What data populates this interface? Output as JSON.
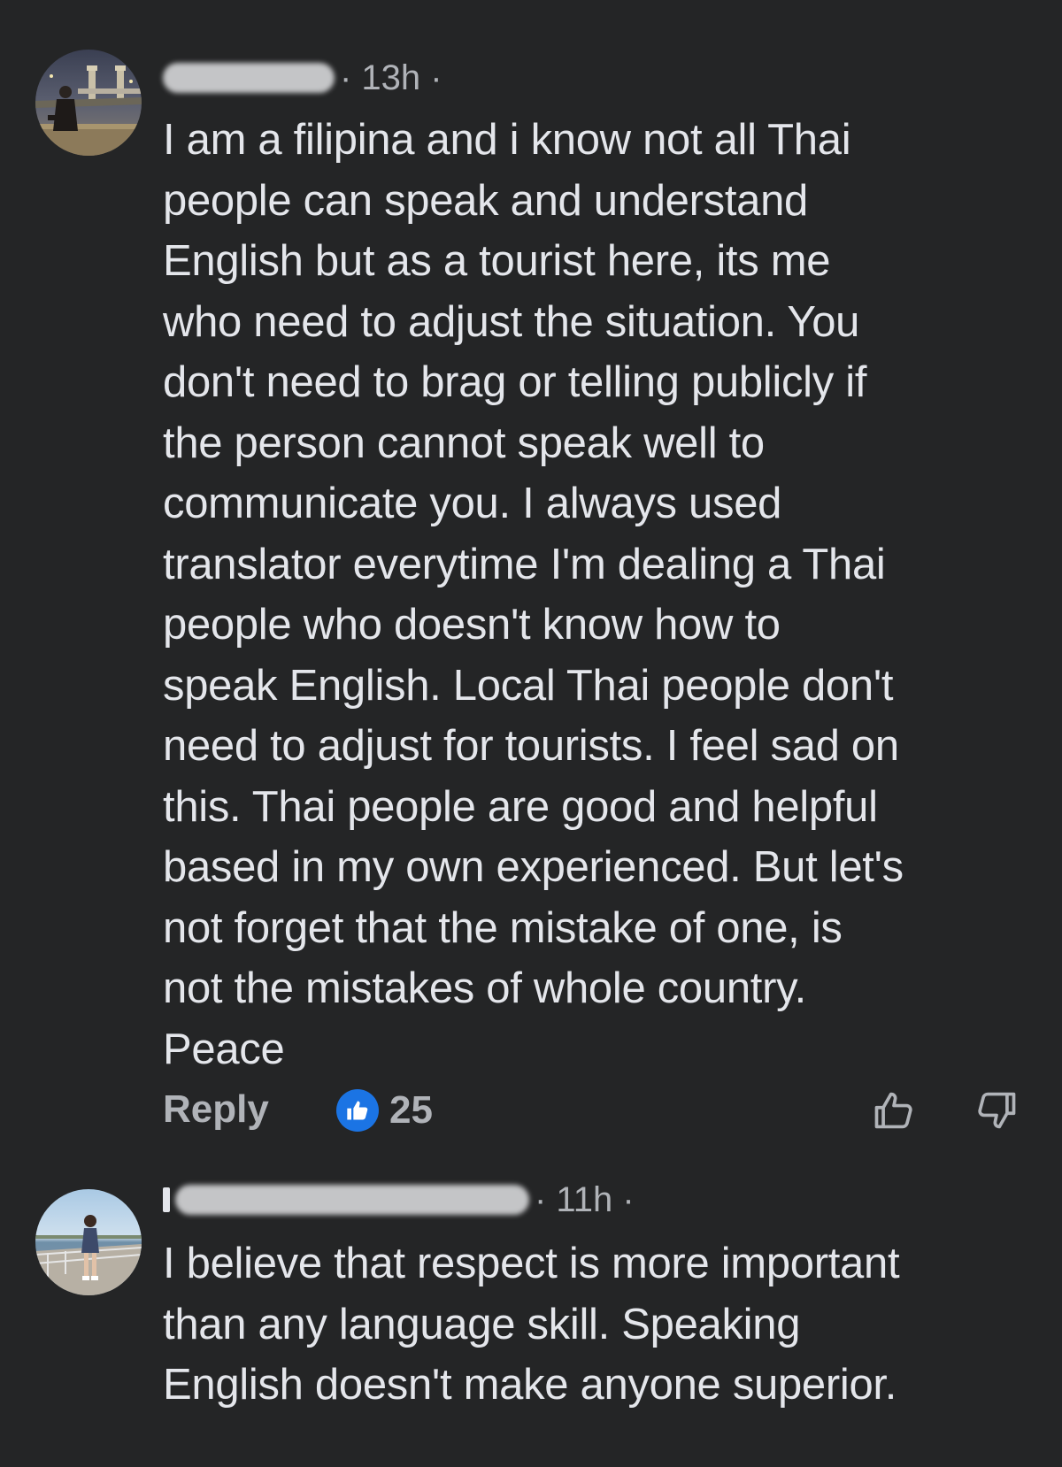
{
  "theme": {
    "background": "#242526",
    "primary_text": "#e4e6eb",
    "secondary_text": "#b0b3b8",
    "like_badge": "#1b74e4"
  },
  "comments": [
    {
      "author_redacted": true,
      "timestamp": "· 13h ·",
      "text": "I am a filipina and i know not all Thai\npeople can speak and understand\nEnglish  but as a tourist here, its me\nwho need to adjust the situation.  You\ndon't need to brag or telling publicly if\nthe person cannot speak well to\ncommunicate you. I always used\ntranslator everytime I'm dealing a Thai\npeople who doesn't know how to\nspeak English.  Local Thai people don't\nneed to adjust for tourists. I feel sad on\nthis. Thai people are good and helpful\nbased in my own experienced. But let's\nnot forget that the mistake of one, is\nnot the mistakes of whole country.\nPeace",
      "reply_label": "Reply",
      "like_count": "25",
      "icons": {
        "like_badge": "thumbs-up-icon",
        "upvote": "thumbs-up-outline-icon",
        "downvote": "thumbs-down-outline-icon"
      }
    },
    {
      "author_redacted": true,
      "timestamp": "· 11h ·",
      "text": "I believe that respect is more important\nthan any language skill. Speaking\nEnglish doesn't make anyone superior."
    }
  ]
}
